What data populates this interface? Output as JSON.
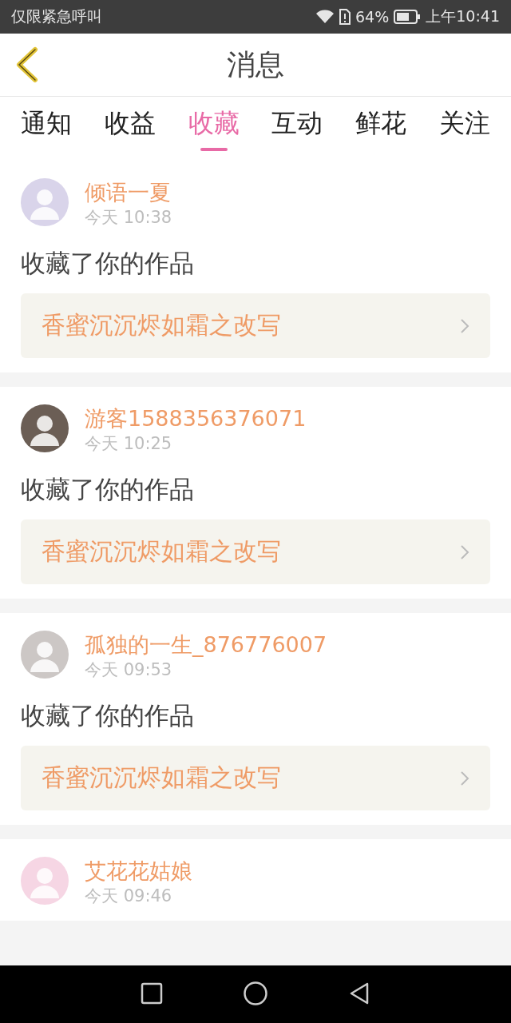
{
  "status_bar": {
    "notice": "仅限紧急呼叫",
    "battery": "64%",
    "time": "上午10:41"
  },
  "header": {
    "title": "消息"
  },
  "tabs": [
    {
      "label": "通知",
      "selected": false
    },
    {
      "label": "收益",
      "selected": false
    },
    {
      "label": "收藏",
      "selected": true
    },
    {
      "label": "互动",
      "selected": false
    },
    {
      "label": "鲜花",
      "selected": false
    },
    {
      "label": "关注",
      "selected": false
    }
  ],
  "messages": [
    {
      "name": "倾语一夏",
      "time": "今天 10:38",
      "action": "收藏了你的作品",
      "work_title": "香蜜沉沉烬如霜之改写"
    },
    {
      "name": "游客1588356376071",
      "time": "今天 10:25",
      "action": "收藏了你的作品",
      "work_title": "香蜜沉沉烬如霜之改写"
    },
    {
      "name": "孤独的一生_876776007",
      "time": "今天 09:53",
      "action": "收藏了你的作品",
      "work_title": "香蜜沉沉烬如霜之改写"
    },
    {
      "name": "艾花花姑娘",
      "time": "今天 09:46"
    }
  ]
}
